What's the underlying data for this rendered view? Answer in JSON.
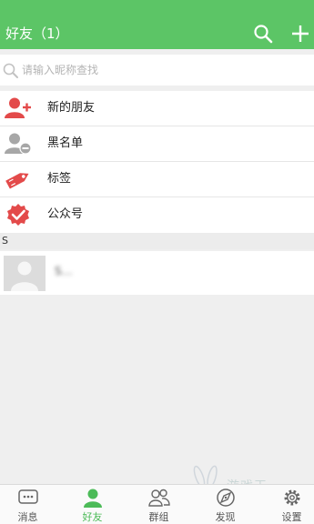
{
  "header": {
    "title": "好友（1）",
    "search_icon": "search-icon",
    "add_icon": "plus-icon",
    "color": "#5cc566"
  },
  "search": {
    "placeholder": "请输入昵称查找"
  },
  "menu": {
    "items": [
      {
        "label": "新的朋友",
        "icon": "add-friend-icon",
        "color": "#e34a4a"
      },
      {
        "label": "黑名单",
        "icon": "blacklist-icon",
        "color": "#a7a7a7"
      },
      {
        "label": "标签",
        "icon": "tag-icon",
        "color": "#e34a4a"
      },
      {
        "label": "公众号",
        "icon": "verified-badge-icon",
        "color": "#e34a4a"
      }
    ]
  },
  "contacts": {
    "section_letter": "S",
    "items": [
      {
        "name": "S…",
        "avatar": "default-avatar-icon"
      }
    ]
  },
  "tabbar": {
    "accent": "#4cbb58",
    "items": [
      {
        "label": "消息",
        "icon": "message-icon"
      },
      {
        "label": "好友",
        "icon": "person-icon",
        "active": true
      },
      {
        "label": "群组",
        "icon": "group-icon"
      },
      {
        "label": "发现",
        "icon": "compass-icon"
      },
      {
        "label": "设置",
        "icon": "gear-icon"
      }
    ]
  },
  "watermark": {
    "text": "游戏天"
  }
}
